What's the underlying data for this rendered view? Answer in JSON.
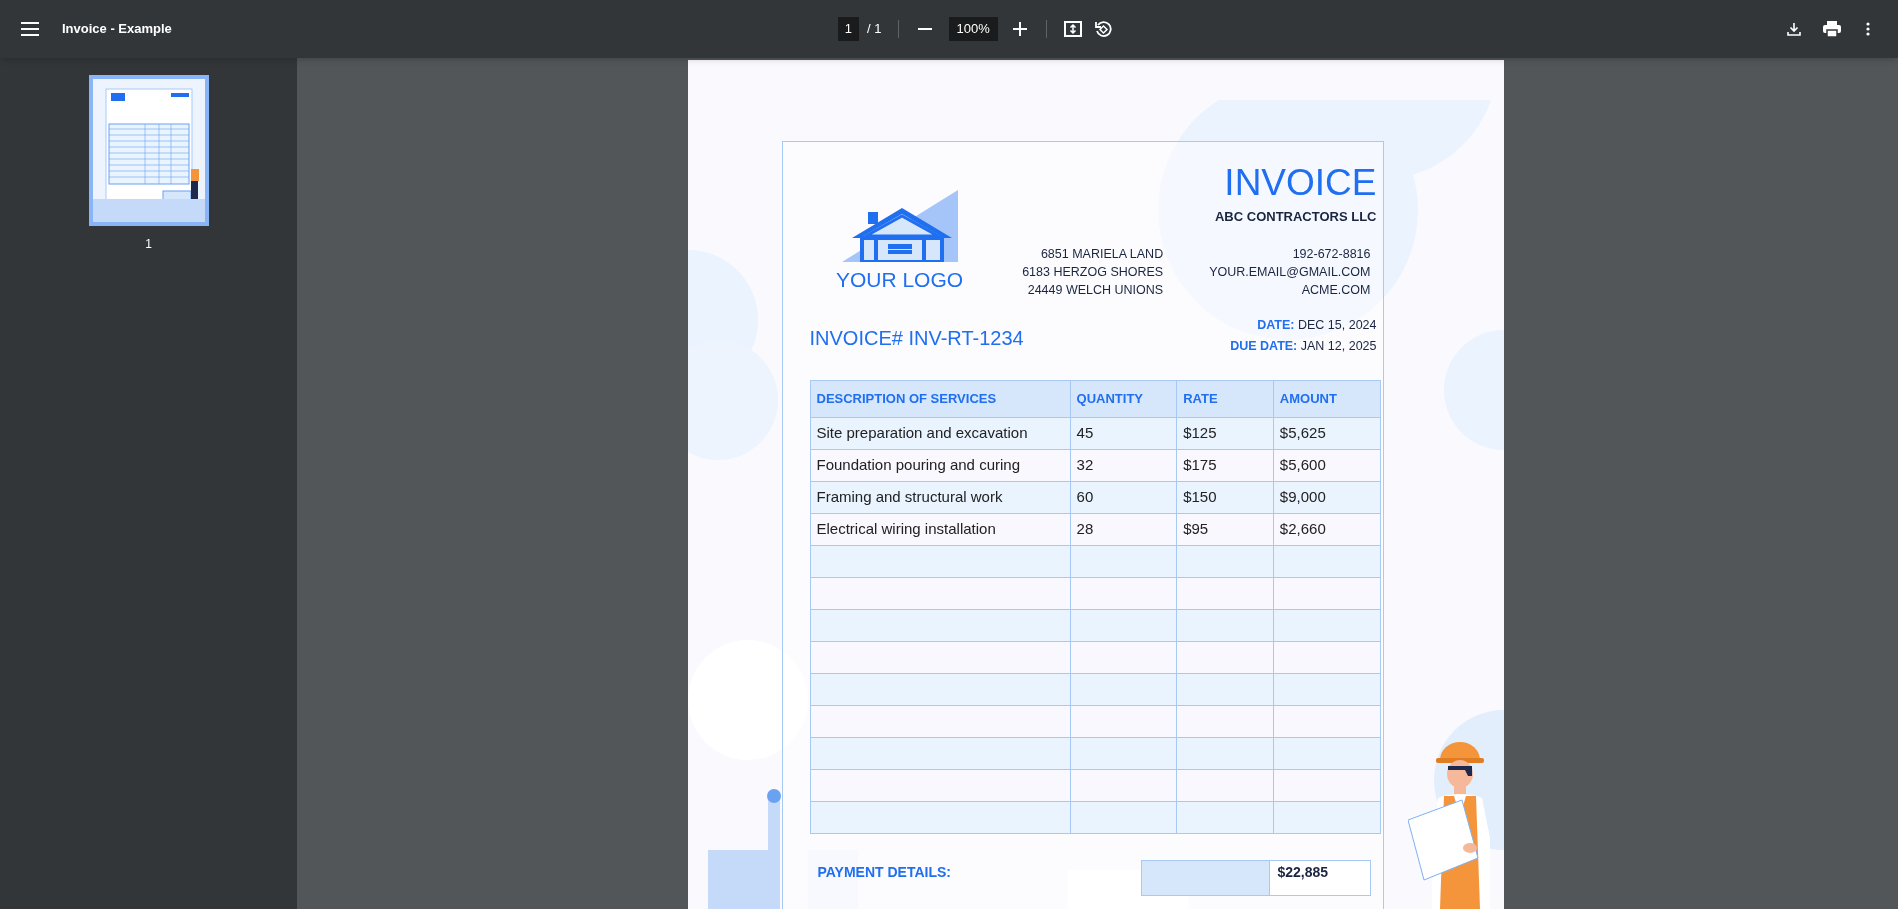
{
  "toolbar": {
    "title": "Invoice - Example",
    "page_input": "1",
    "page_count": "/ 1",
    "zoom": "100%"
  },
  "sidebar": {
    "thumbnails": [
      {
        "label": "1",
        "selected": true
      }
    ]
  },
  "invoice": {
    "title": "INVOICE",
    "company": "ABC CONTRACTORS LLC",
    "logo_text": "YOUR LOGO",
    "address": [
      "6851 MARIELA LAND",
      "6183 HERZOG SHORES",
      "24449 WELCH UNIONS"
    ],
    "contacts": [
      "192-672-8816",
      "YOUR.EMAIL@GMAIL.COM",
      "ACME.COM"
    ],
    "number": "INVOICE# INV-RT-1234",
    "dates": [
      {
        "label": "DATE:",
        "value": "DEC 15, 2024"
      },
      {
        "label": "DUE DATE:",
        "value": "JAN 12, 2025"
      }
    ],
    "table": {
      "columns": [
        "DESCRIPTION OF SERVICES",
        "QUANTITY",
        "RATE",
        "AMOUNT"
      ],
      "rows": [
        {
          "kind": "item",
          "cells": [
            "Site preparation and excavation",
            "45",
            "$125",
            "$5,625"
          ]
        },
        {
          "kind": "item",
          "cells": [
            "Foundation pouring and curing",
            "32",
            "$175",
            "$5,600"
          ]
        },
        {
          "kind": "item",
          "cells": [
            "Framing and structural work",
            "60",
            "$150",
            "$9,000"
          ]
        },
        {
          "kind": "item",
          "cells": [
            "Electrical wiring installation",
            "28",
            "$95",
            "$2,660"
          ]
        },
        {
          "kind": "blank"
        },
        {
          "kind": "blank"
        },
        {
          "kind": "blank"
        },
        {
          "kind": "blank"
        },
        {
          "kind": "blank"
        },
        {
          "kind": "blank"
        },
        {
          "kind": "blank"
        },
        {
          "kind": "blank"
        },
        {
          "kind": "blank"
        }
      ]
    },
    "payment": {
      "heading": "PAYMENT DETAILS:",
      "total": "$22,885"
    }
  }
}
